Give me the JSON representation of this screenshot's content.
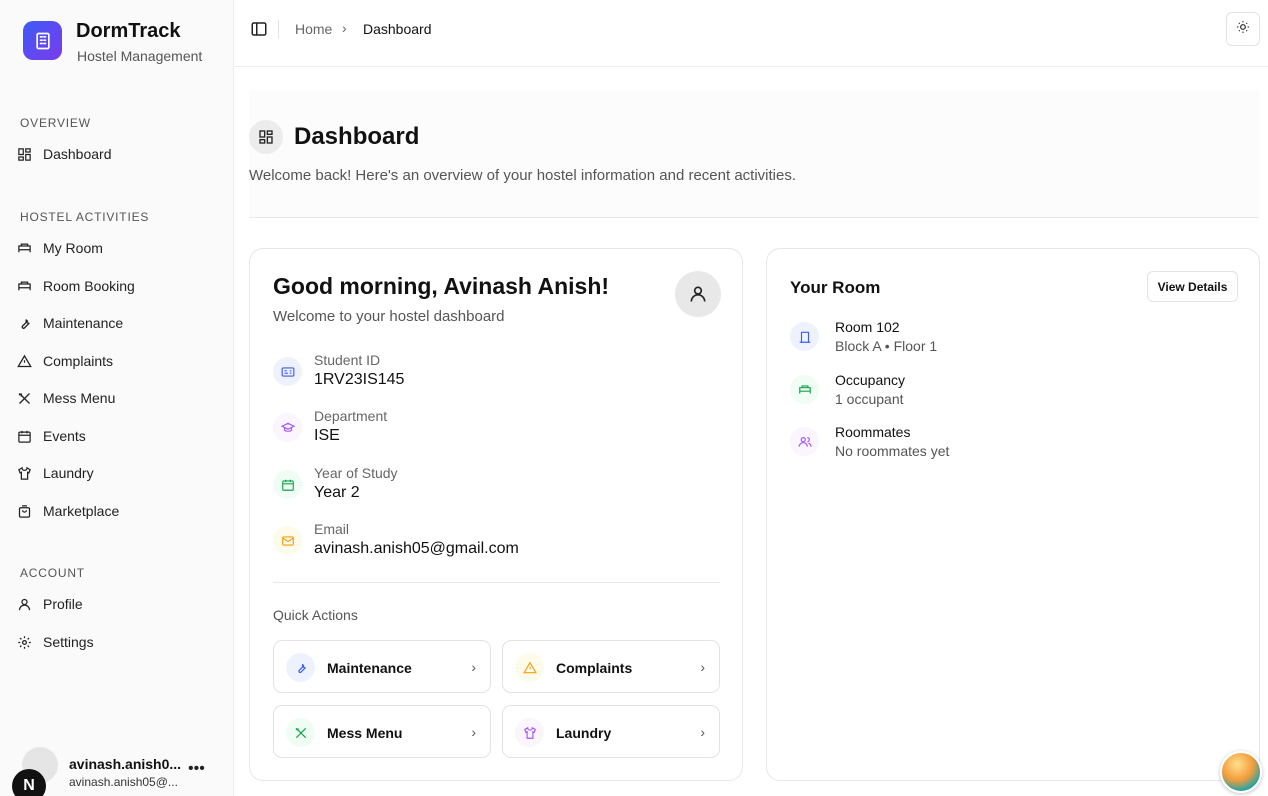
{
  "brand": {
    "title": "DormTrack",
    "subtitle": "Hostel Management"
  },
  "sidebar": {
    "overview_label": "OVERVIEW",
    "overview_items": [
      {
        "label": "Dashboard",
        "icon": "dashboard-icon"
      }
    ],
    "activities_label": "HOSTEL ACTIVITIES",
    "activity_items": [
      {
        "label": "My Room",
        "icon": "bed-icon"
      },
      {
        "label": "Room Booking",
        "icon": "bed-icon"
      },
      {
        "label": "Maintenance",
        "icon": "wrench-icon"
      },
      {
        "label": "Complaints",
        "icon": "warning-icon"
      },
      {
        "label": "Mess Menu",
        "icon": "utensils-icon"
      },
      {
        "label": "Events",
        "icon": "calendar-icon"
      },
      {
        "label": "Laundry",
        "icon": "shirt-icon"
      },
      {
        "label": "Marketplace",
        "icon": "shopping-bag-icon"
      }
    ],
    "account_label": "ACCOUNT",
    "account_items": [
      {
        "label": "Profile",
        "icon": "user-icon"
      },
      {
        "label": "Settings",
        "icon": "gear-icon"
      }
    ],
    "user": {
      "name": "avinash.anish0...",
      "email": "avinash.anish05@...",
      "badge": "N"
    }
  },
  "topbar": {
    "home": "Home",
    "separator": "›",
    "current": "Dashboard"
  },
  "header": {
    "title": "Dashboard",
    "subtitle": "Welcome back! Here's an overview of your hostel information and recent activities."
  },
  "welcome": {
    "greeting": "Good morning, Avinash Anish!",
    "subtitle": "Welcome to your hostel dashboard",
    "fields": [
      {
        "label": "Student ID",
        "value": "1RV23IS145",
        "icon": "id-card-icon",
        "color": "#3b5cf5"
      },
      {
        "label": "Department",
        "value": "ISE",
        "icon": "graduation-cap-icon",
        "color": "#a855f7"
      },
      {
        "label": "Year of Study",
        "value": "Year 2",
        "icon": "calendar-icon",
        "color": "#16a34a"
      },
      {
        "label": "Email",
        "value": "avinash.anish05@gmail.com",
        "icon": "mail-icon",
        "color": "#f59e0b"
      }
    ],
    "quick_actions_label": "Quick Actions",
    "quick_actions": [
      {
        "label": "Maintenance",
        "icon": "wrench-icon",
        "color": "#3b5cf5"
      },
      {
        "label": "Complaints",
        "icon": "warning-icon",
        "color": "#f59e0b"
      },
      {
        "label": "Mess Menu",
        "icon": "utensils-icon",
        "color": "#16a34a"
      },
      {
        "label": "Laundry",
        "icon": "shirt-icon",
        "color": "#a855f7"
      }
    ]
  },
  "room": {
    "title": "Your Room",
    "view_details": "View Details",
    "rows": [
      {
        "main": "Room 102",
        "sub": "Block A • Floor 1",
        "icon": "door-icon",
        "color": "#3b5cf5"
      },
      {
        "main": "Occupancy",
        "sub": "1 occupant",
        "icon": "bed-icon",
        "color": "#16a34a"
      },
      {
        "main": "Roommates",
        "sub": "No roommates yet",
        "icon": "users-icon",
        "color": "#a855f7"
      }
    ]
  }
}
